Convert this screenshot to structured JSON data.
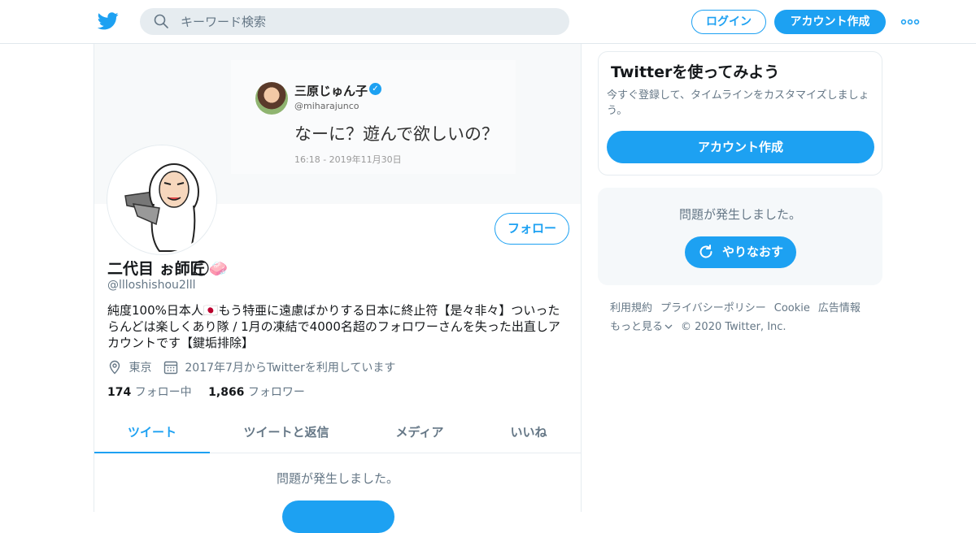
{
  "header": {
    "search_placeholder": "キーワード検索",
    "login_label": "ログイン",
    "signup_label": "アカウント作成"
  },
  "banner_tweet": {
    "name": "三原じゅん子",
    "handle": "@miharajunco",
    "text": "なーに？遊んで欲しいの？",
    "time": "16:18 - 2019年11月30日",
    "verified_mark": "✓"
  },
  "profile": {
    "name": "二代目 ぉ師匠 ⃝🧼",
    "handle": "@llloshishou2lll",
    "bio": "純度100%日本人🇯🇵もう特亜に遠慮ばかりする日本に終止符【是々非々】ついったらんどは楽しくあり隊 / 1月の凍結で4000名超のフォロワーさんを失った出直しアカウントです【鍵垢排除】",
    "location": "東京",
    "joined": "2017年7月からTwitterを利用しています",
    "following_count": "174",
    "following_label": "フォロー中",
    "followers_count": "1,866",
    "followers_label": "フォロワー",
    "follow_button": "フォロー"
  },
  "tabs": [
    {
      "label": "ツイート",
      "active": true
    },
    {
      "label": "ツイートと返信",
      "active": false
    },
    {
      "label": "メディア",
      "active": false
    },
    {
      "label": "いいね",
      "active": false
    }
  ],
  "timeline": {
    "error_text": "問題が発生しました。"
  },
  "sidebar": {
    "promo_title": "Twitterを使ってみよう",
    "promo_text": "今すぐ登録して、タイムラインをカスタマイズしましょう。",
    "promo_button": "アカウント作成",
    "error_text": "問題が発生しました。",
    "retry_button": "やりなおす"
  },
  "footer": {
    "links": [
      "利用規約",
      "プライバシーポリシー",
      "Cookie",
      "広告情報"
    ],
    "more": "もっと見る",
    "copyright": "© 2020 Twitter, Inc."
  },
  "colors": {
    "accent": "#1da1f2",
    "secondary_text": "#657786"
  }
}
